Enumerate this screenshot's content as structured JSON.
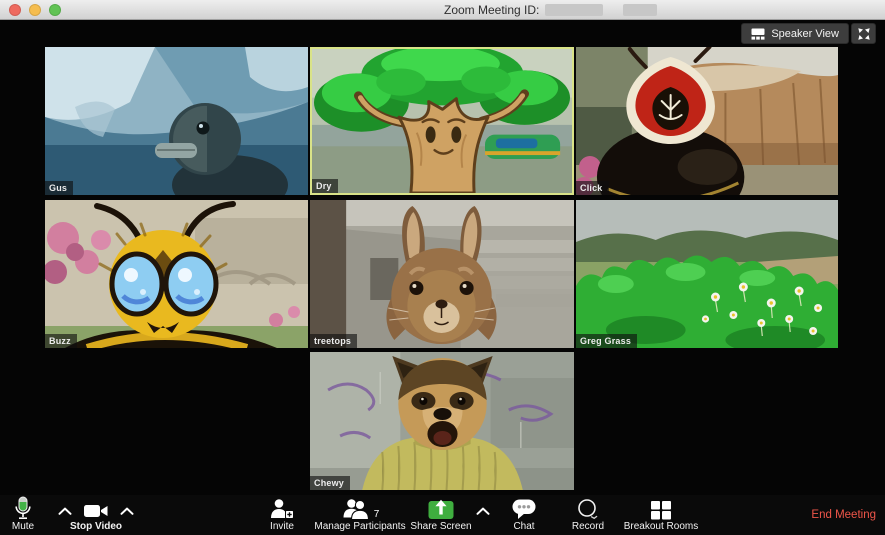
{
  "titlebar": {
    "title": "Zoom Meeting ID:"
  },
  "top_controls": {
    "speaker_view": "Speaker View"
  },
  "participants": [
    {
      "name": "Gus"
    },
    {
      "name": "Dry",
      "active_speaker": true
    },
    {
      "name": "Click"
    },
    {
      "name": "Buzz"
    },
    {
      "name": "treetops"
    },
    {
      "name": "Greg Grass"
    },
    {
      "name": "Chewy"
    }
  ],
  "toolbar": {
    "mute": "Mute",
    "stop_video": "Stop Video",
    "invite": "Invite",
    "manage_participants": "Manage Participants",
    "participants_count": "7",
    "share_screen": "Share Screen",
    "chat": "Chat",
    "record": "Record",
    "breakout_rooms": "Breakout Rooms",
    "end_meeting": "End Meeting"
  },
  "colors": {
    "share_screen_green": "#3fae3f",
    "mic_level_green": "#43b347",
    "end_meeting_red": "#ef564a",
    "active_speaker_border": "#d9e388"
  }
}
